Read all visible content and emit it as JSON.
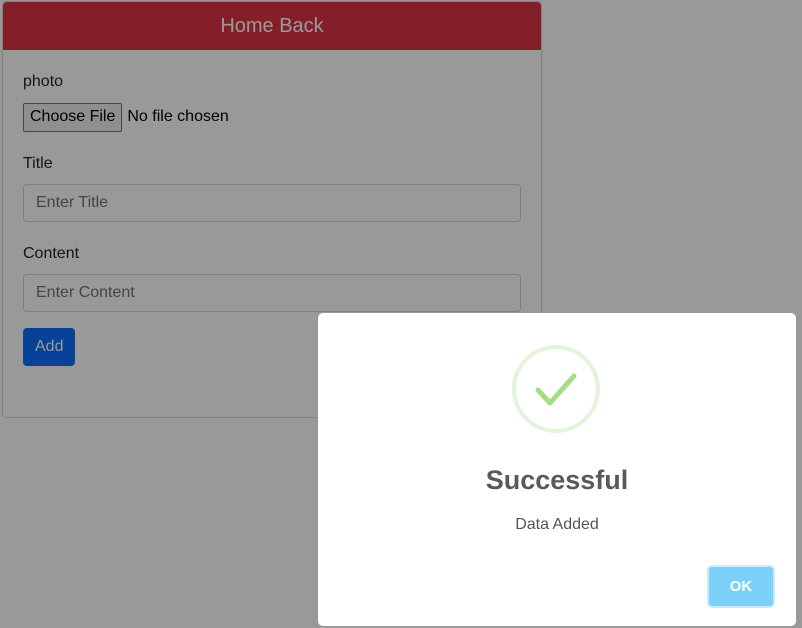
{
  "header": {
    "back_label": "Home Back"
  },
  "form": {
    "photo": {
      "label": "photo",
      "button_label": "Choose File",
      "status": "No file chosen"
    },
    "title": {
      "label": "Title",
      "placeholder": "Enter Title",
      "value": ""
    },
    "content": {
      "label": "Content",
      "placeholder": "Enter Content",
      "value": ""
    },
    "submit_label": "Add"
  },
  "alert": {
    "icon": "success-check-icon",
    "title": "Successful",
    "text": "Data Added",
    "ok_label": "OK"
  },
  "colors": {
    "header_bg": "#dc3545",
    "primary": "#0d6efd",
    "success_check": "#a5dc86",
    "ok_button": "#7cd1f9"
  }
}
